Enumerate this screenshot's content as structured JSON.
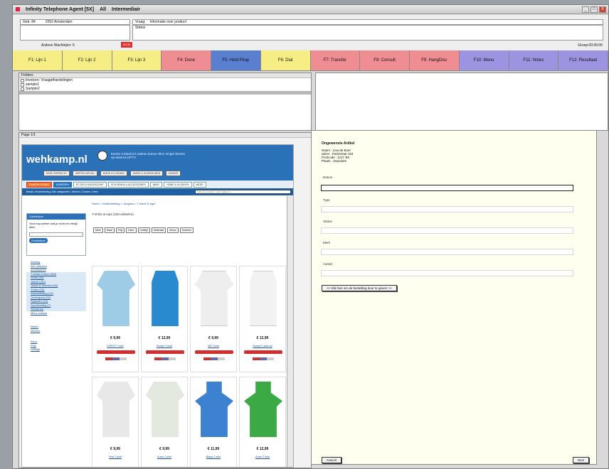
{
  "window": {
    "title": "Infinity Telephone Agent [5X]",
    "title_extra": "All",
    "title_extra2": "Intermediair",
    "btn_min": "_",
    "btn_max": "□",
    "btn_close": "X"
  },
  "info": {
    "row1_a": "Geb. 84",
    "row1_b": "2002 Amsterdam",
    "row1_c": "Vraag:",
    "row1_d": "Informatie over product",
    "row2_a": "Status",
    "row3_a": "Actieve Wachtrijen: 6",
    "timer": "00:00",
    "right_stamp": "Groep:00:00:00"
  },
  "fkeys": [
    {
      "label": "F1: Lijn 1",
      "color": "#f6ee84"
    },
    {
      "label": "F2: Lijn 2",
      "color": "#f6ee84"
    },
    {
      "label": "F3: Lijn 3",
      "color": "#f6ee84"
    },
    {
      "label": "F4: Done",
      "color": "#f08d93"
    },
    {
      "label": "F5: Hold Pkup",
      "color": "#5b7fd0"
    },
    {
      "label": "F6: Dial",
      "color": "#f6ee84"
    },
    {
      "label": "F7: Transfer",
      "color": "#f08d93"
    },
    {
      "label": "F8: Consult",
      "color": "#f08d93"
    },
    {
      "label": "F9: HangDisc",
      "color": "#f08d93"
    },
    {
      "label": "F10: Menu",
      "color": "#9c94e0"
    },
    {
      "label": "F11: Notes",
      "color": "#9c94e0"
    },
    {
      "label": "F12: Resultaat",
      "color": "#9c94e0"
    }
  ],
  "leftpanel": {
    "title": "Folders",
    "items": [
      "Invoicen: Vraagafhandelingen",
      "sample1",
      "Sample2"
    ]
  },
  "page": {
    "title": "Page 1/1"
  },
  "web": {
    "logo": "wehkamp.nl",
    "promo": "Eerste 3 Maak lid cadeau bonus Alles Vinger binnen op www.KLUP.TV",
    "nav": [
      "MIJN OVERZICHT",
      "BESTELLEN NU",
      "MODE & KLEDING",
      "MODE & HUISHOUDEN",
      "KINDER"
    ],
    "cats": [
      "DAMESKLEDING",
      "KINDEREN",
      "BT-JEN & BOODSCHAP",
      "SCHOENEN & ACCESSORIES",
      "BABY",
      "HOME & KLOKKEN",
      "MEER"
    ],
    "bluebar": "Bekijk | Kinderkleding | Alle categorieën | Merken | Zoeken | Meer",
    "search": "Zoek een product / merk / artikel nr.",
    "crumb": "Home > Kinderkleding > Jongens > T-shirts & tops",
    "title": "T-shirts & tops (150 artikelen)",
    "side_title": "Zoekhelper",
    "side_text": "Vind nog sneller wat je zoekt en bekijk alles",
    "side_btn": "Zoekhelper",
    "sidelist": [
      "Kleding",
      "Alle artikelen",
      "Accessoires",
      "T-shirts & tops (150)",
      "Shirts (40)",
      "Jassen (30)",
      "Jeans & broeken (60)",
      "Truien (20)",
      "Zwemkleding (12)",
      "Ondergoed (20)",
      "Pyjama's (12)",
      "Sportkleding (7)",
      "Schoenen",
      "Meer zoeken"
    ],
    "side_extra": [
      "Maten",
      "Merken",
      "Kleur",
      "Prijs",
      "Leeftijd"
    ],
    "filters": [
      "Merk",
      "Maat",
      "Prijs",
      "Kleur",
      "Leeftijd",
      "Materiaal",
      "Mouw",
      "Sorteren"
    ],
    "products": [
      {
        "price": "€ 9,99",
        "name": "ESPRIT T-shirt",
        "color": "#9ecbe6"
      },
      {
        "price": "€ 12,99",
        "name": "Rumph T-shirt",
        "color": "#2a8ad0"
      },
      {
        "price": "€ 9,99",
        "name": "Wit T-shirt",
        "color": "#eeeeee"
      },
      {
        "price": "€ 12,99",
        "name": "Rumph T-shirt wit",
        "color": "#f2f2f2"
      },
      {
        "price": "€ 9,99",
        "name": "Print T-shirt",
        "color": "#e8e8e8"
      },
      {
        "price": "€ 9,99",
        "name": "Groen T-shirt",
        "color": "#e4e9e0"
      },
      {
        "price": "€ 11,99",
        "name": "Blauw T-shirt",
        "color": "#3d82d0"
      },
      {
        "price": "€ 12,99",
        "name": "Groen T-shirt",
        "color": "#3caa44"
      }
    ]
  },
  "form": {
    "heading": "Ongewenste Artikel",
    "meta": [
      "Naam : Lisa de Boer",
      "adres : Parkstraat 193",
      "Postcode : 1127 BK",
      "Plaats : Zaandam"
    ],
    "fields": [
      "Datum",
      "Type",
      "Status",
      "Merk",
      "Aantal"
    ],
    "button": "<< Klik hier om de bestelling door te geven >>",
    "cancel": "Cancel",
    "next": "Next"
  }
}
